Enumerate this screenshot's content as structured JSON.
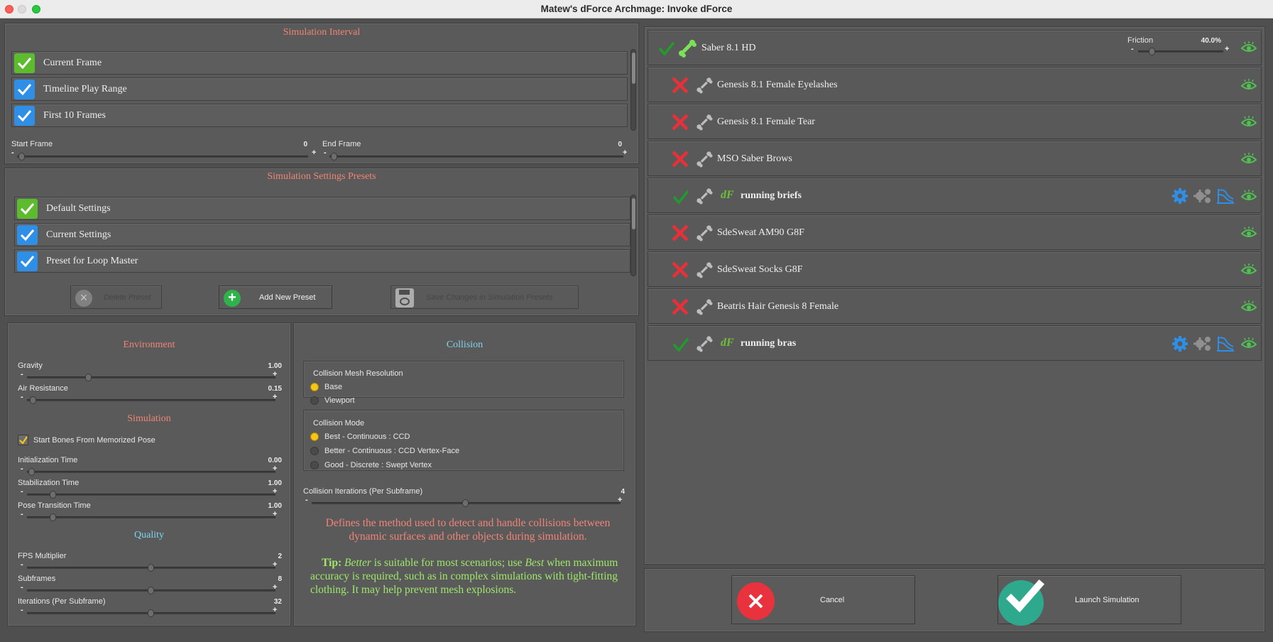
{
  "window": {
    "title": "Matew's dForce Archmage: Invoke dForce"
  },
  "interval": {
    "title": "Simulation Interval",
    "items": [
      {
        "label": "Current Frame",
        "checked": true,
        "color": "green"
      },
      {
        "label": "Timeline Play Range",
        "checked": true,
        "color": "blue"
      },
      {
        "label": "First 10 Frames",
        "checked": true,
        "color": "blue"
      }
    ],
    "start_frame": {
      "label": "Start Frame",
      "value": "0"
    },
    "end_frame": {
      "label": "End Frame",
      "value": "0"
    }
  },
  "presets": {
    "title": "Simulation Settings Presets",
    "items": [
      {
        "label": "Default Settings",
        "checked": true,
        "color": "green"
      },
      {
        "label": "Current Settings",
        "checked": true,
        "color": "blue"
      },
      {
        "label": "Preset for Loop Master",
        "checked": true,
        "color": "blue"
      }
    ],
    "delete_label": "Delete Preset",
    "add_label": "Add New Preset",
    "save_label": "Save Changes in Simulation Presets"
  },
  "environment": {
    "title": "Environment",
    "gravity": {
      "label": "Gravity",
      "value": "1.00",
      "level": 0.25
    },
    "air": {
      "label": "Air Resistance",
      "value": "0.15",
      "level": 0.03
    }
  },
  "simulation": {
    "title": "Simulation",
    "start_bones": {
      "label": "Start Bones From Memorized Pose",
      "checked": true
    },
    "init_time": {
      "label": "Initialization Time",
      "value": "0.00",
      "level": 0.0
    },
    "stab_time": {
      "label": "Stabilization Time",
      "value": "1.00",
      "level": 0.1
    },
    "pose_time": {
      "label": "Pose Transition Time",
      "value": "1.00",
      "level": 0.1
    }
  },
  "quality": {
    "title": "Quality",
    "fps": {
      "label": "FPS Multiplier",
      "value": "2",
      "level": 0.5
    },
    "subframes": {
      "label": "Subframes",
      "value": "8",
      "level": 0.5
    },
    "iterations": {
      "label": "Iterations (Per Subframe)",
      "value": "32",
      "level": 0.5
    }
  },
  "collision": {
    "title": "Collision",
    "mesh_res": {
      "label": "Collision Mesh Resolution",
      "options": [
        "Base",
        "Viewport"
      ],
      "selected": "Base"
    },
    "mode": {
      "label": "Collision Mode",
      "options": [
        "Best - Continuous : CCD",
        "Better - Continuous : CCD Vertex-Face",
        "Good - Discrete : Swept Vertex"
      ],
      "selected": "Best - Continuous : CCD"
    },
    "iterations": {
      "label": "Collision Iterations (Per Subframe)",
      "value": "4",
      "level": 0.5
    },
    "desc": "Defines the method used to detect and handle collisions between dynamic surfaces and other objects during simulation.",
    "tip_label": "Tip:",
    "tip_b1": "Better",
    "tip_t1": " is suitable for most scenarios; use ",
    "tip_b2": "Best",
    "tip_t2": " when maximum accuracy is required, such as in complex simulations with tight-fitting clothing. It may help prevent mesh explosions."
  },
  "figures": [
    {
      "name": "Saber 8.1 HD",
      "enabled": true,
      "bone": "green",
      "friction_label": "Friction",
      "friction_value": "40.0%",
      "friction_level": 0.1
    },
    {
      "name": "Genesis 8.1 Female Eyelashes",
      "enabled": false
    },
    {
      "name": "Genesis 8.1 Female Tear",
      "enabled": false
    },
    {
      "name": "MSO Saber Brows",
      "enabled": false
    },
    {
      "name": "running briefs",
      "enabled": true,
      "dforce": true,
      "dforce_label": "dF"
    },
    {
      "name": "SdeSweat AM90 G8F",
      "enabled": false
    },
    {
      "name": "SdeSweat Socks G8F",
      "enabled": false
    },
    {
      "name": "Beatris Hair Genesis 8 Female",
      "enabled": false
    },
    {
      "name": "running bras",
      "enabled": true,
      "dforce": true,
      "dforce_label": "dF"
    }
  ],
  "actions": {
    "cancel_label": "Cancel",
    "launch_label": "Launch Simulation"
  },
  "colors": {
    "accent_salmon": "#f08476",
    "accent_cyan": "#7fd4f0",
    "tip_green": "#9ee86a",
    "check_green": "#5dbb2e",
    "check_blue": "#2f8ee6",
    "x_red": "#e8303a"
  }
}
